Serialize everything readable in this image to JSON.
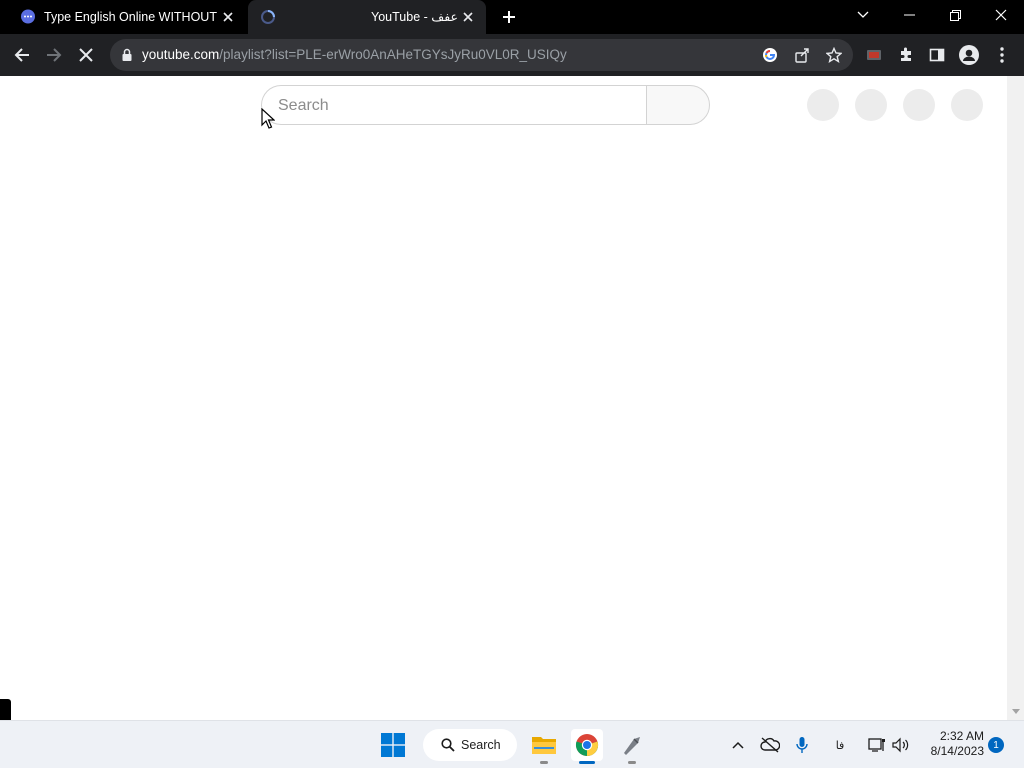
{
  "browser": {
    "tabs": [
      {
        "title": "Type English Online WITHOUT ar",
        "favicon": "chat-bubble-icon",
        "active": false
      },
      {
        "title": "YouTube - عفف",
        "favicon": "loading-spinner-icon",
        "active": true
      }
    ],
    "url_host": "youtube.com",
    "url_path": "/playlist?list=PLE-erWro0AnAHeTGYsJyRu0VL0R_USIQy",
    "colors": {
      "tabstrip": "#000000",
      "toolbar": "#202124",
      "omnibox": "#35363a"
    }
  },
  "page": {
    "search_placeholder": "Search"
  },
  "taskbar": {
    "search_label": "Search",
    "ime_label": "فا",
    "time": "2:32 AM",
    "date": "8/14/2023",
    "notification_count": "1",
    "colors": {
      "start": "#0078d4",
      "badge": "#0067c0"
    }
  }
}
